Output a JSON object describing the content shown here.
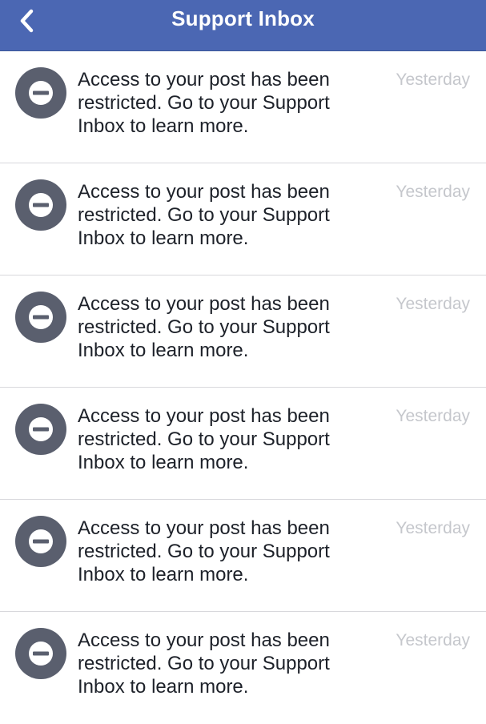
{
  "header": {
    "title": "Support Inbox",
    "back_icon": "chevron-left-icon",
    "background_color": "#4b67b3"
  },
  "notifications": [
    {
      "icon": "restricted-icon",
      "message": "Access to your post has been restricted. Go to your Support Inbox to learn more.",
      "time": "Yesterday"
    },
    {
      "icon": "restricted-icon",
      "message": "Access to your post has been restricted. Go to your Support Inbox to learn more.",
      "time": "Yesterday"
    },
    {
      "icon": "restricted-icon",
      "message": "Access to your post has been restricted. Go to your Support Inbox to learn more.",
      "time": "Yesterday"
    },
    {
      "icon": "restricted-icon",
      "message": "Access to your post has been restricted. Go to your Support Inbox to learn more.",
      "time": "Yesterday"
    },
    {
      "icon": "restricted-icon",
      "message": "Access to your post has been restricted. Go to your Support Inbox to learn more.",
      "time": "Yesterday"
    },
    {
      "icon": "restricted-icon",
      "message": "Access to your post has been restricted. Go to your Support Inbox to learn more.",
      "time": "Yesterday"
    }
  ]
}
